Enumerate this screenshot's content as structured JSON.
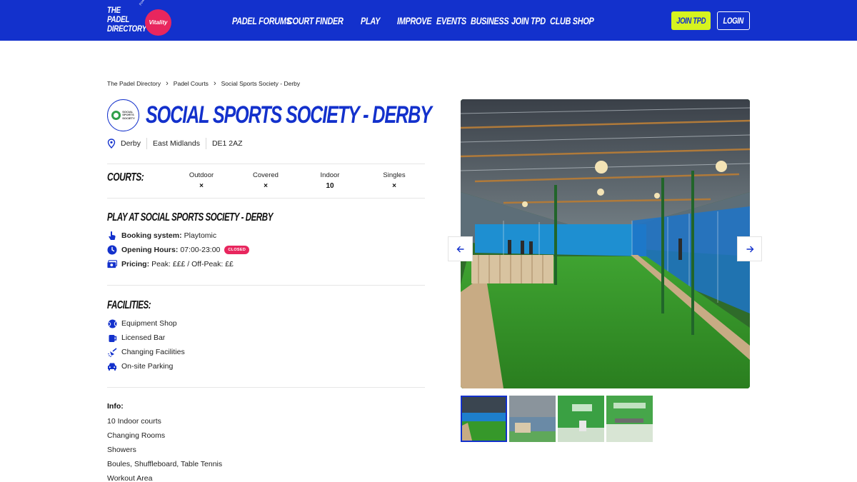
{
  "header": {
    "logo_text_lines": [
      "THE",
      "PADEL",
      "DIRECTORY"
    ],
    "logo_badge": "Vitality",
    "logo_powered": "Powered by",
    "nav": [
      "PADEL FORUMS",
      "COURT FINDER",
      "PLAY",
      "IMPROVE",
      "EVENTS",
      "BUSINESS",
      "JOIN TPD",
      "CLUB SHOP"
    ],
    "join_label": "JOIN TPD",
    "login_label": "LOGIN",
    "colors": {
      "bar": "#1331cc",
      "join_bg": "#d6f31f"
    }
  },
  "breadcrumb": [
    "The Padel Directory",
    "Padel Courts",
    "Social Sports Society - Derby"
  ],
  "club": {
    "logo_text": [
      "SOCIAL",
      "SPORTS",
      "SOCIETY"
    ],
    "title": "SOCIAL SPORTS SOCIETY - DERBY",
    "location": [
      "Derby",
      "East Midlands",
      "DE1 2AZ"
    ]
  },
  "courts": {
    "label": "COURTS:",
    "columns": [
      {
        "name": "Outdoor",
        "value": "×"
      },
      {
        "name": "Covered",
        "value": "×"
      },
      {
        "name": "Indoor",
        "value": "10"
      },
      {
        "name": "Singles",
        "value": "×"
      }
    ]
  },
  "play": {
    "heading": "PLAY AT SOCIAL SPORTS SOCIETY - DERBY",
    "booking_label": "Booking system:",
    "booking_value": "Playtomic",
    "hours_label": "Opening Hours:",
    "hours_value": "07:00-23:00",
    "hours_status": "CLOSED",
    "pricing_label": "Pricing:",
    "pricing_value": "Peak: £££ / Off-Peak: ££"
  },
  "facilities": {
    "heading": "FACILITIES:",
    "items": [
      {
        "label": "Equipment Shop",
        "icon": "tennis-ball-icon"
      },
      {
        "label": "Licensed Bar",
        "icon": "mug-icon"
      },
      {
        "label": "Changing Facilities",
        "icon": "shower-icon"
      },
      {
        "label": "On-site Parking",
        "icon": "car-icon"
      }
    ]
  },
  "info": {
    "heading": "Info:",
    "lines": [
      "10 Indoor courts",
      "Changing Rooms",
      "Showers",
      "Boules, Shuffleboard, Table Tennis",
      "Workout Area"
    ]
  },
  "gallery": {
    "prev_icon": "arrow-left-icon",
    "next_icon": "arrow-right-icon",
    "thumb_count": 4,
    "active_thumb": 0
  },
  "colors": {
    "accent": "#1331cc",
    "closed_badge": "#e8265e",
    "court_turf": "#3c9a2a",
    "court_blue": "#1d74c8"
  }
}
